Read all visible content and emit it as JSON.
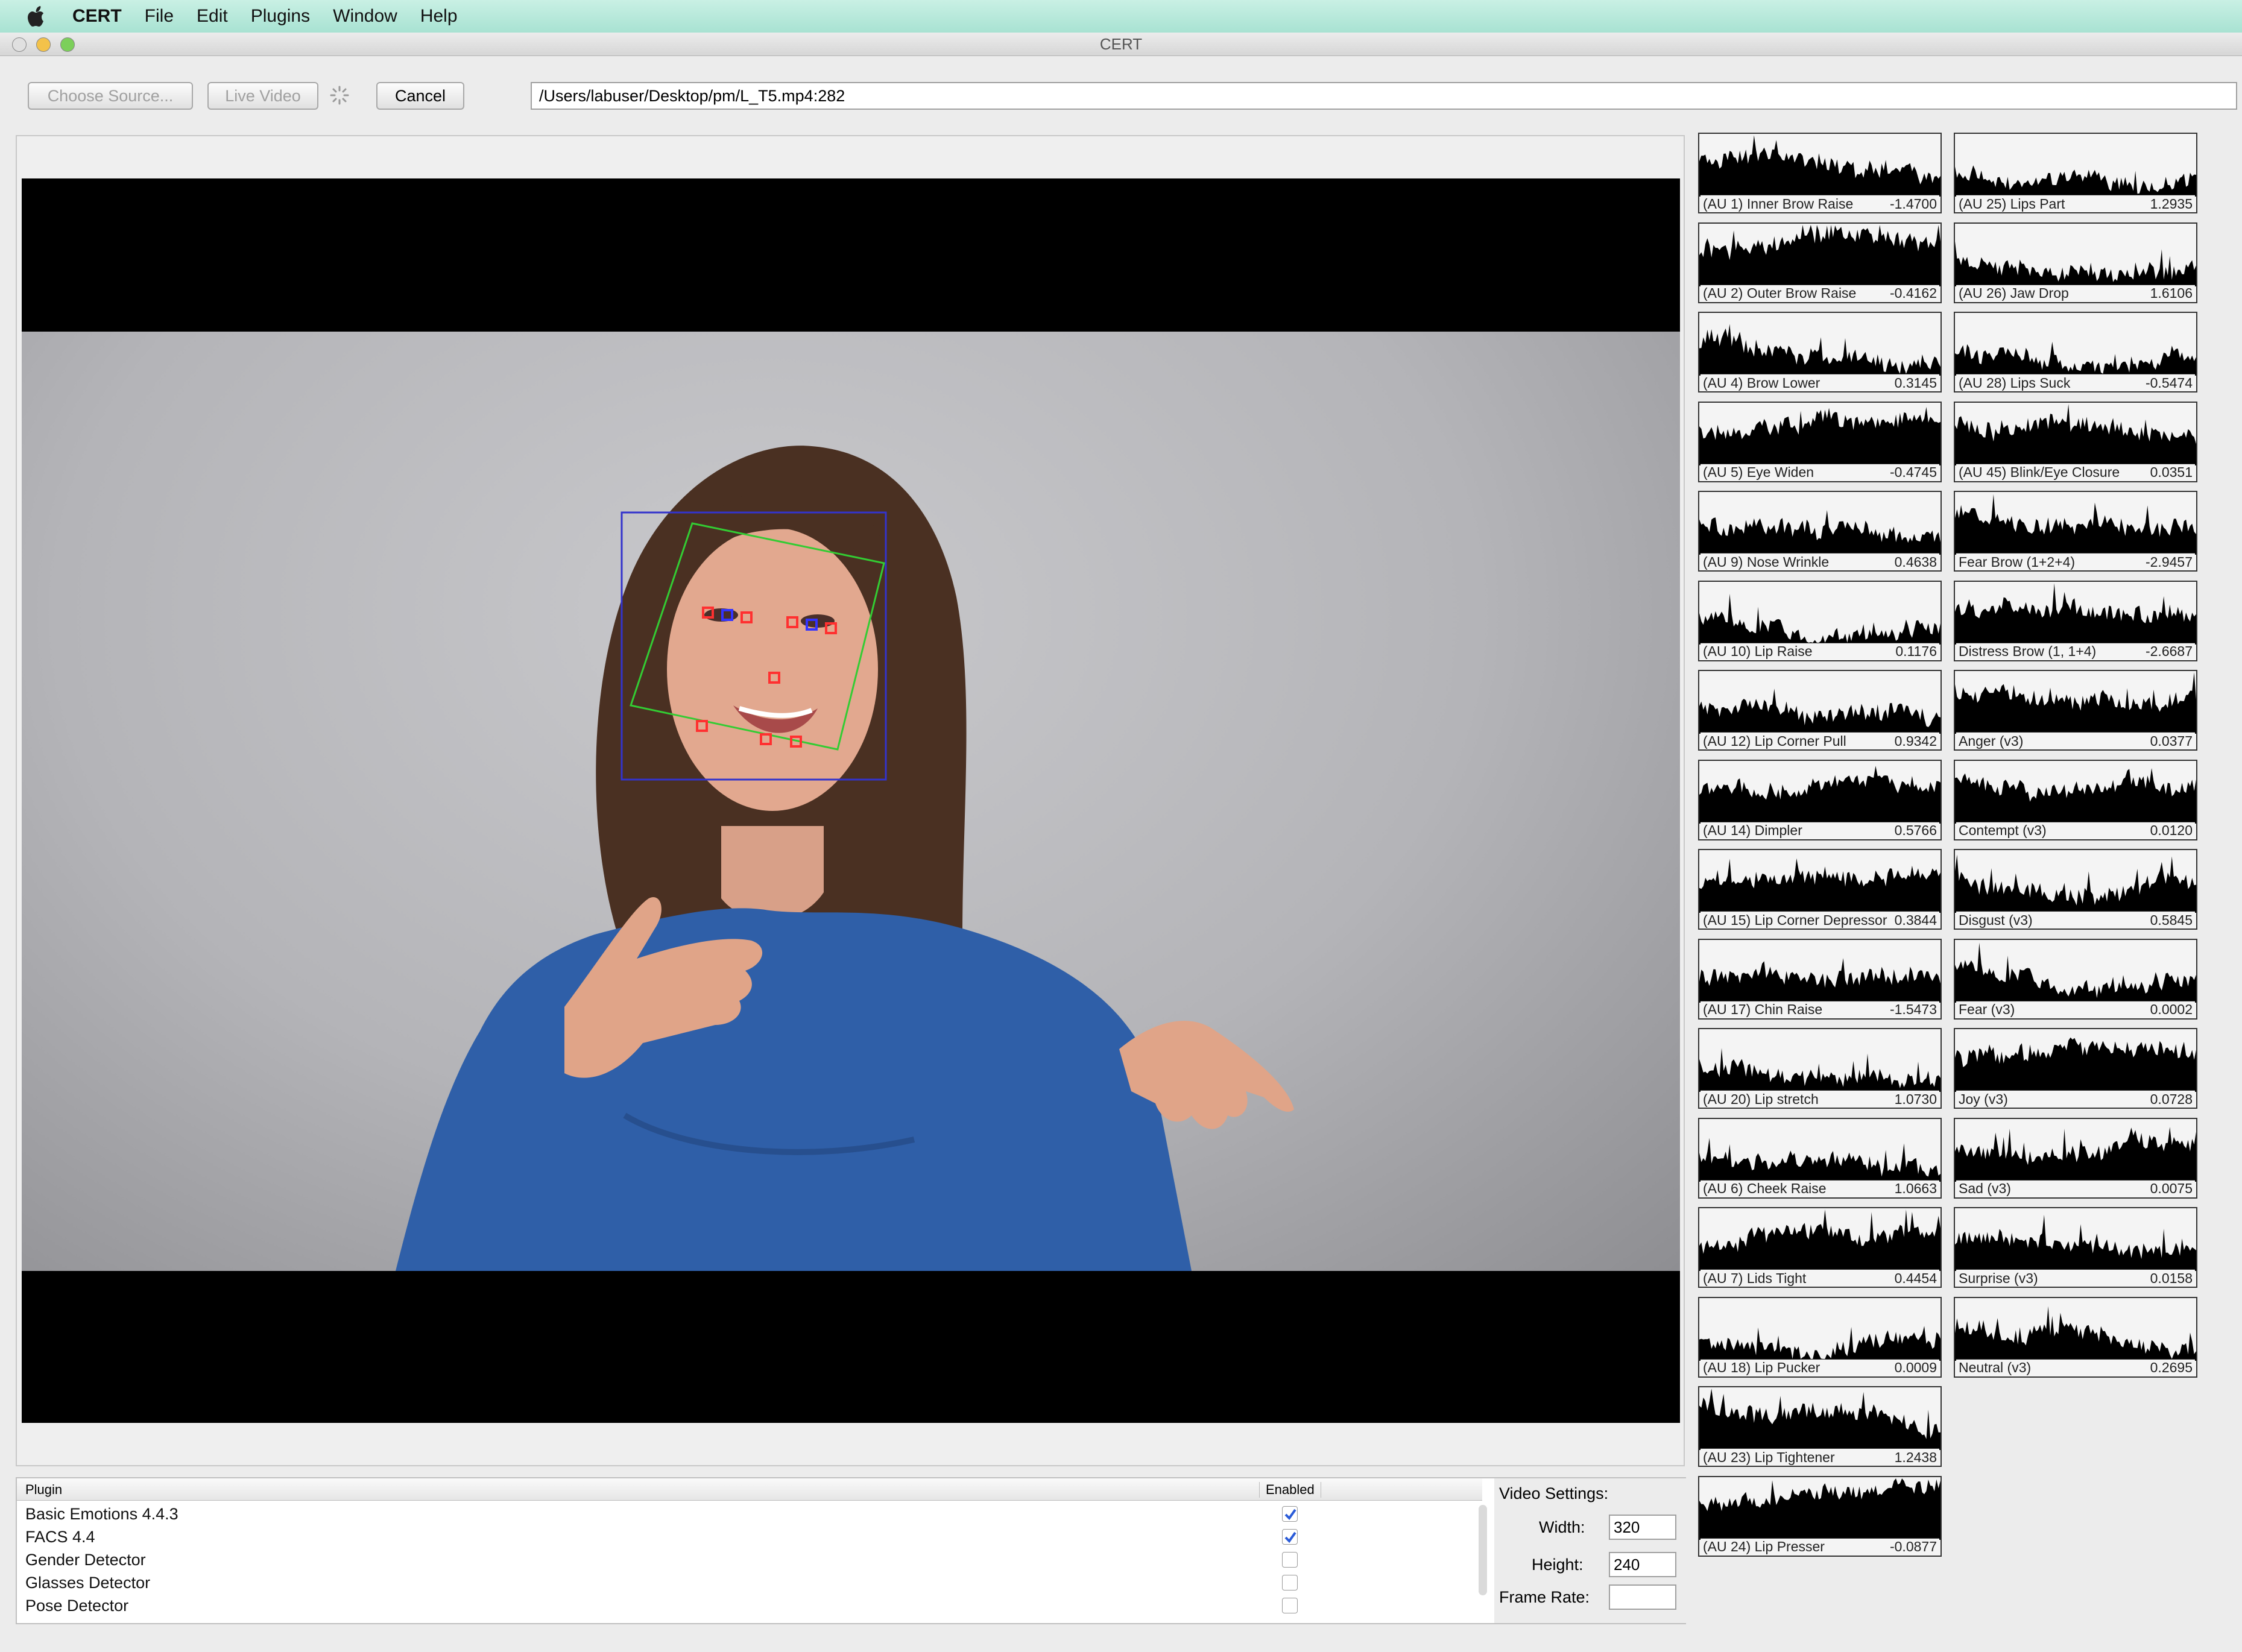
{
  "menubar": {
    "apple_icon": "apple-icon",
    "app_name": "CERT",
    "items": [
      "File",
      "Edit",
      "Plugins",
      "Window",
      "Help"
    ]
  },
  "window": {
    "title": "CERT"
  },
  "toolbar": {
    "choose_source": "Choose Source...",
    "live_video": "Live Video",
    "cancel": "Cancel",
    "path": "/Users/labuser/Desktop/pm/L_T5.mp4:282"
  },
  "plots": [
    {
      "label": "(AU 1) Inner Brow Raise",
      "value": "-1.4700"
    },
    {
      "label": "(AU 25) Lips Part",
      "value": "1.2935"
    },
    {
      "label": "(AU 2) Outer Brow Raise",
      "value": "-0.4162"
    },
    {
      "label": "(AU 26) Jaw Drop",
      "value": "1.6106"
    },
    {
      "label": "(AU 4) Brow Lower",
      "value": "0.3145"
    },
    {
      "label": "(AU 28) Lips Suck",
      "value": "-0.5474"
    },
    {
      "label": "(AU 5) Eye Widen",
      "value": "-0.4745"
    },
    {
      "label": "(AU 45) Blink/Eye Closure",
      "value": "0.0351"
    },
    {
      "label": "(AU 9) Nose Wrinkle",
      "value": "0.4638"
    },
    {
      "label": "Fear Brow (1+2+4)",
      "value": "-2.9457"
    },
    {
      "label": "(AU 10) Lip Raise",
      "value": "0.1176"
    },
    {
      "label": "Distress Brow (1, 1+4)",
      "value": "-2.6687"
    },
    {
      "label": "(AU 12) Lip Corner Pull",
      "value": "0.9342"
    },
    {
      "label": "Anger (v3)",
      "value": "0.0377"
    },
    {
      "label": "(AU 14) Dimpler",
      "value": "0.5766"
    },
    {
      "label": "Contempt (v3)",
      "value": "0.0120"
    },
    {
      "label": "(AU 15) Lip Corner Depressor",
      "value": "0.3844"
    },
    {
      "label": "Disgust (v3)",
      "value": "0.5845"
    },
    {
      "label": "(AU 17) Chin Raise",
      "value": "-1.5473"
    },
    {
      "label": "Fear (v3)",
      "value": "0.0002"
    },
    {
      "label": "(AU 20) Lip stretch",
      "value": "1.0730"
    },
    {
      "label": "Joy (v3)",
      "value": "0.0728"
    },
    {
      "label": "(AU 6) Cheek Raise",
      "value": "1.0663"
    },
    {
      "label": "Sad (v3)",
      "value": "0.0075"
    },
    {
      "label": "(AU 7) Lids Tight",
      "value": "0.4454"
    },
    {
      "label": "Surprise (v3)",
      "value": "0.0158"
    },
    {
      "label": "(AU 18) Lip Pucker",
      "value": "0.0009"
    },
    {
      "label": "Neutral (v3)",
      "value": "0.2695"
    },
    {
      "label": "(AU 23) Lip Tightener",
      "value": "1.2438"
    },
    {
      "label": "(AU 24) Lip Presser",
      "value": "-0.0877"
    }
  ],
  "plugins": {
    "header_plugin": "Plugin",
    "header_enabled": "Enabled",
    "rows": [
      {
        "name": "Basic Emotions 4.4.3",
        "enabled": true
      },
      {
        "name": "FACS 4.4",
        "enabled": true
      },
      {
        "name": "Gender Detector",
        "enabled": false
      },
      {
        "name": "Glasses Detector",
        "enabled": false
      },
      {
        "name": "Pose Detector",
        "enabled": false
      }
    ]
  },
  "video_settings": {
    "title": "Video Settings:",
    "width_label": "Width:",
    "width_value": "320",
    "height_label": "Height:",
    "height_value": "240",
    "frame_rate_label": "Frame Rate:",
    "frame_rate_value": ""
  },
  "colors": {
    "face_box": "#3333cc",
    "face_pose": "#33cc33",
    "landmarks": "#ff3030",
    "shirt": "#2f5fa8"
  }
}
